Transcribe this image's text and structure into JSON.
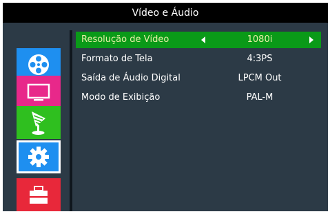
{
  "window": {
    "title": "Vídeo e Áudio"
  },
  "sidebar": {
    "items": [
      {
        "icon": "film-reel-icon",
        "color": "#1e8ff0"
      },
      {
        "icon": "tv-screen-icon",
        "color": "#e8288a"
      },
      {
        "icon": "satellite-dish-icon",
        "color": "#2fbf1f"
      },
      {
        "icon": "gear-icon",
        "color": "#1e8ff0",
        "selected": true
      },
      {
        "icon": "toolbox-icon",
        "color": "#e8283a"
      }
    ]
  },
  "menu": {
    "rows": [
      {
        "label": "Resolução de Vídeo",
        "value": "1080i",
        "selected": true
      },
      {
        "label": "Formato de Tela",
        "value": "4:3PS"
      },
      {
        "label": "Saída de Áudio Digital",
        "value": "LPCM Out"
      },
      {
        "label": "Modo de Exibição",
        "value": "PAL-M"
      }
    ]
  },
  "colors": {
    "background": "#2c3a46",
    "title_bar": "#000000",
    "highlight": "#0a9a18",
    "highlight_text": "#e9f0a8"
  }
}
